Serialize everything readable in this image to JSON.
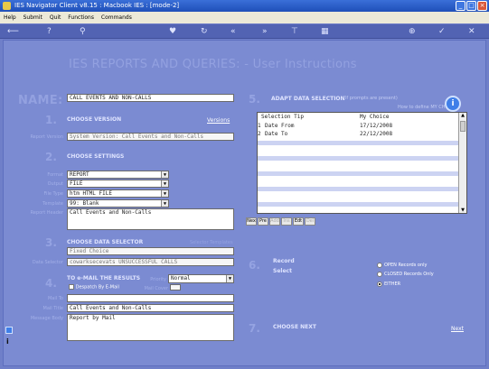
{
  "window": {
    "title": "IES Navigator Client v8.15 : Macbook IES :         [mode-2]"
  },
  "menu": [
    "Help",
    "Submit",
    "Quit",
    "Functions",
    "Commands"
  ],
  "page": {
    "heading": "IES REPORTS AND QUERIES: - User Instructions"
  },
  "name": {
    "label": "NAME:",
    "value": "CALL EVENTS AND NON-CALLS"
  },
  "sec1": {
    "num": "1.",
    "title": "CHOOSE VERSION",
    "versions_link": "Versions",
    "label": "Report Version",
    "value": "System Version: Call Events and Non-Calls"
  },
  "sec2": {
    "num": "2.",
    "title": "CHOOSE SETTINGS",
    "format_label": "Format",
    "format_value": "REPORT",
    "output_label": "Output",
    "output_value": "FILE",
    "filetype_label": "File Type",
    "filetype_value": "htm HTML FILE",
    "template_label": "Template",
    "template_value": "99: Blank",
    "header_label": "Report Header",
    "header_value": "Call Events and Non-Calls"
  },
  "sec3": {
    "num": "3.",
    "title": "CHOOSE DATA SELECTOR",
    "link": "Selector Templates",
    "fixed": "Fixed Choice",
    "label": "Data Selector",
    "value": "cowarksecevats UNSUCCESSFUL CALLS"
  },
  "sec4": {
    "num": "4.",
    "title": "TO e-MAIL THE RESULTS",
    "priority_label": "Priority",
    "priority_value": "Normal",
    "despatch_label": "Despatch By E-Mail",
    "mailcover_label": "Mail Cover",
    "mailto_label": "Mail To",
    "mailtitle_label": "Mail Title",
    "mailtitle_value": "Call Events and Non-Calls",
    "body_label": "Message Body",
    "body_value": "Report by Mail"
  },
  "sec5": {
    "num": "5.",
    "title": "ADAPT DATA SELECTION",
    "subtitle": "(If prompts are present)",
    "hint": "How to define MY CHOICE",
    "columns": [
      "Selection Tip",
      "My Choice"
    ],
    "rows": [
      {
        "n": "1",
        "tip": "Date From",
        "choice": "17/12/2008"
      },
      {
        "n": "2",
        "tip": "Date To",
        "choice": "22/12/2008"
      }
    ],
    "nav": [
      "Nex",
      "Pre",
      "Add",
      "Ins",
      "Edt",
      "Del"
    ]
  },
  "sec6": {
    "num": "6.",
    "record_label": "Record",
    "select_label": "Select",
    "options": [
      "OPEN Records only",
      "CLOSED Records Only",
      "EITHER"
    ],
    "selected": "EITHER"
  },
  "sec7": {
    "num": "7.",
    "title": "CHOOSE NEXT",
    "next_link": "Next"
  }
}
